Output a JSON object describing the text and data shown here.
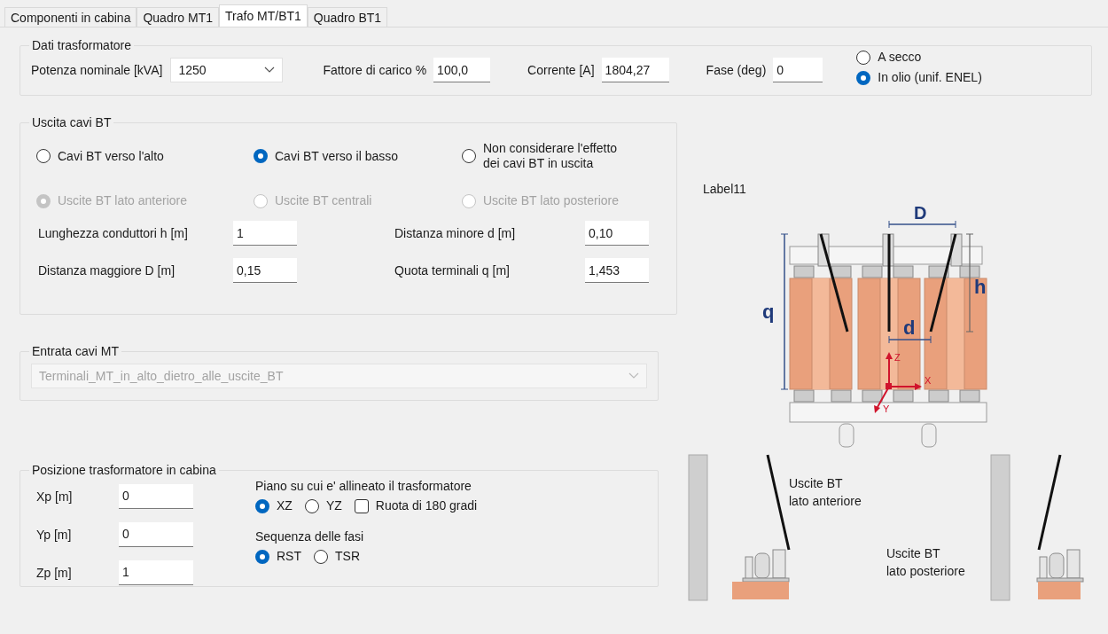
{
  "tabs": [
    {
      "label": "Componenti in cabina",
      "selected": false
    },
    {
      "label": "Quadro MT1",
      "selected": false
    },
    {
      "label": "Trafo MT/BT1",
      "selected": true
    },
    {
      "label": "Quadro BT1",
      "selected": false
    }
  ],
  "dati_trasformatore": {
    "title": "Dati trasformatore",
    "potenza_nominale": {
      "label": "Potenza nominale [kVA]",
      "value": "1250"
    },
    "fields": [
      {
        "label": "Fattore di carico %",
        "value": "100,0"
      },
      {
        "label": "Corrente [A]",
        "value": "1804,27"
      },
      {
        "label": "Fase (deg)",
        "value": "0"
      }
    ],
    "tipo": [
      {
        "label": "A secco",
        "selected": false
      },
      {
        "label": "In olio (unif. ENEL)",
        "selected": true
      }
    ]
  },
  "uscita_cavi_bt": {
    "title": "Uscita cavi BT",
    "direzione": [
      {
        "label": "Cavi BT verso l'alto",
        "selected": false
      },
      {
        "label": "Cavi BT verso il basso",
        "selected": true
      },
      {
        "label": "Non considerare l'effetto\ndei cavi BT in uscita",
        "selected": false
      }
    ],
    "posizione_uscite": [
      {
        "label": "Uscite BT lato anteriore",
        "selected": true,
        "disabled": true
      },
      {
        "label": "Uscite BT centrali",
        "selected": false,
        "disabled": true
      },
      {
        "label": "Uscite BT lato posteriore",
        "selected": false,
        "disabled": true
      }
    ],
    "fields": [
      {
        "label": "Lunghezza conduttori h [m]",
        "value": "1"
      },
      {
        "label": "Distanza minore  d [m]",
        "value": "0,10"
      },
      {
        "label": "Distanza maggiore D [m]",
        "value": "0,15"
      },
      {
        "label": "Quota terminali q [m]",
        "value": "1,453"
      }
    ]
  },
  "entrata_cavi_mt": {
    "title": "Entrata cavi MT",
    "value": "Terminali_MT_in_alto_dietro_alle_uscite_BT",
    "disabled": true
  },
  "posizione_trasformatore": {
    "title": "Posizione trasformatore in cabina",
    "fields": [
      {
        "label": "Xp [m]",
        "value": "0"
      },
      {
        "label": "Yp [m]",
        "value": "0"
      },
      {
        "label": "Zp [m]",
        "value": "1"
      }
    ],
    "piano_label": "Piano su cui e' allineato il trasformatore",
    "piano": [
      {
        "label": "XZ",
        "selected": true
      },
      {
        "label": "YZ",
        "selected": false
      }
    ],
    "ruota": {
      "label": "Ruota di 180 gradi",
      "checked": false
    },
    "sequenza_label": "Sequenza delle fasi",
    "sequenza": [
      {
        "label": "RST",
        "selected": true
      },
      {
        "label": "TSR",
        "selected": false
      }
    ]
  },
  "diagram": {
    "caption": "Label11",
    "dimensions": {
      "D": "D",
      "q": "q",
      "h": "h",
      "d": "d"
    },
    "axes": {
      "z": "Z",
      "x": "X",
      "y": "Y"
    },
    "callouts": [
      "Uscite BT\nlato anteriore",
      "Uscite BT\nlato posteriore"
    ]
  }
}
